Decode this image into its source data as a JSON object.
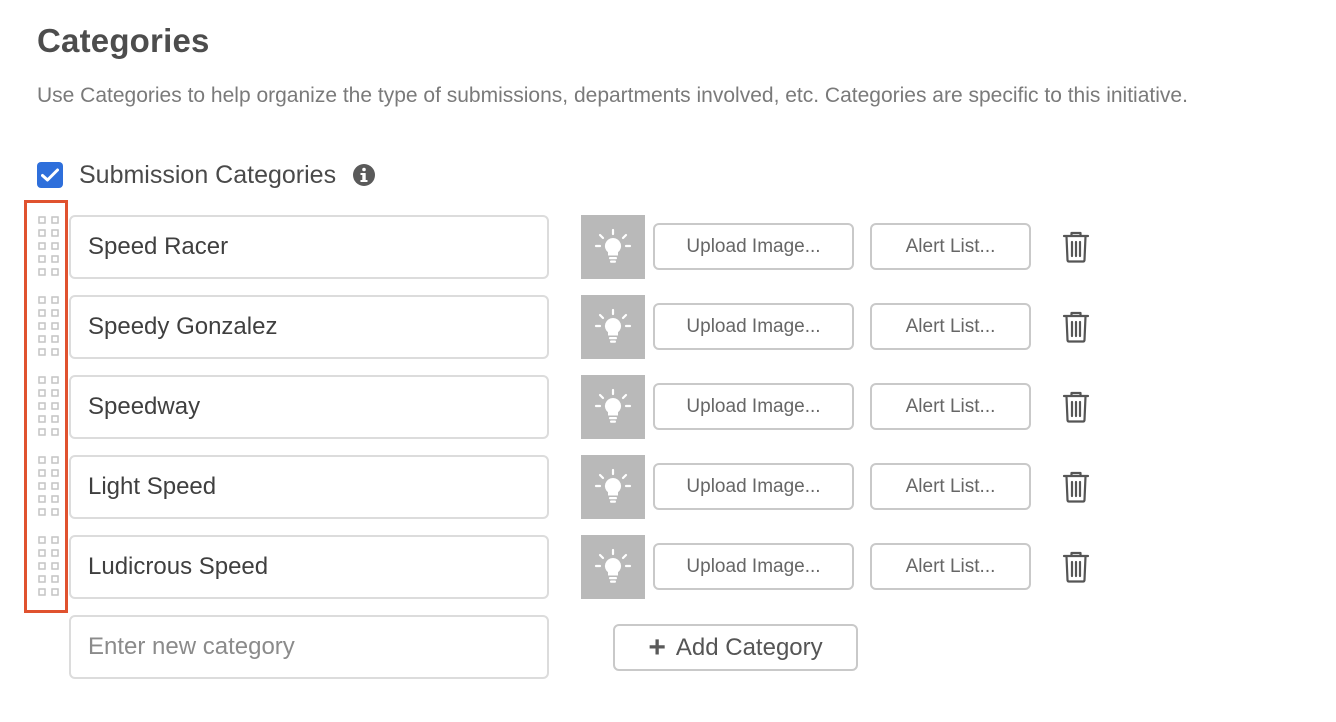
{
  "page": {
    "title": "Categories",
    "description": "Use Categories to help organize the type of submissions, departments involved, etc. Categories are specific to this initiative."
  },
  "section": {
    "checkbox_checked": true,
    "label": "Submission Categories",
    "info_icon": "info-circle-icon"
  },
  "categories": [
    {
      "name": "Speed Racer",
      "upload_label": "Upload Image...",
      "alert_label": "Alert List...",
      "icon": "lightbulb-icon"
    },
    {
      "name": "Speedy Gonzalez",
      "upload_label": "Upload Image...",
      "alert_label": "Alert List...",
      "icon": "lightbulb-icon"
    },
    {
      "name": "Speedway",
      "upload_label": "Upload Image...",
      "alert_label": "Alert List...",
      "icon": "lightbulb-icon"
    },
    {
      "name": "Light Speed",
      "upload_label": "Upload Image...",
      "alert_label": "Alert List...",
      "icon": "lightbulb-icon"
    },
    {
      "name": "Ludicrous Speed",
      "upload_label": "Upload Image...",
      "alert_label": "Alert List...",
      "icon": "lightbulb-icon"
    }
  ],
  "new_category": {
    "value": "",
    "placeholder": "Enter new category",
    "add_label": "Add Category",
    "add_icon": "plus-icon"
  },
  "colors": {
    "checkbox": "#2e6fdb",
    "highlight_border": "#e0522f",
    "icon_tile": "#b9b9b9"
  }
}
